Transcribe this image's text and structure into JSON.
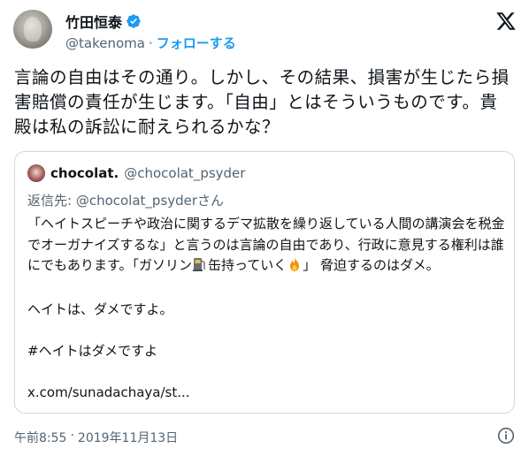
{
  "author": {
    "display_name": "竹田恒泰",
    "handle": "@takenoma",
    "separator": "·",
    "follow_label": "フォローする"
  },
  "tweet": {
    "text": "言論の自由はその通り。しかし、その結果、損害が生じたら損害賠償の責任が生じます。「自由」とはそういうものです。貴殿は私の訴訟に耐えられるかな？",
    "timestamp": "午前8:55",
    "date": "2019年11月13日",
    "footer_separator": "·"
  },
  "quote": {
    "display_name": "chocolat.",
    "handle": "@chocolat_psyder",
    "reply_to": "返信先: @chocolat_psyderさん",
    "body_part1": "「ヘイトスピーチや政治に関するデマ拡散を繰り返している人間の講演会を税金でオーガナイズするな」と言うのは言論の自由であり、行政に意見する権利は誰にでもあります。「ガソリン",
    "body_part2": "缶持っていく",
    "body_part3": "」 脅迫するのはダメ。\n\nヘイトは、ダメですよ。\n\n#ヘイトはダメですよ\n\nx.com/sunadachaya/st..."
  },
  "icons": {
    "verified": "verified-badge-icon",
    "x_logo": "x-logo-icon",
    "fuel": "fuel-pump-icon",
    "fire": "fire-icon",
    "info": "info-icon"
  },
  "colors": {
    "accent": "#1d9bf0",
    "secondary_text": "#536471",
    "border": "#cfd9de"
  }
}
